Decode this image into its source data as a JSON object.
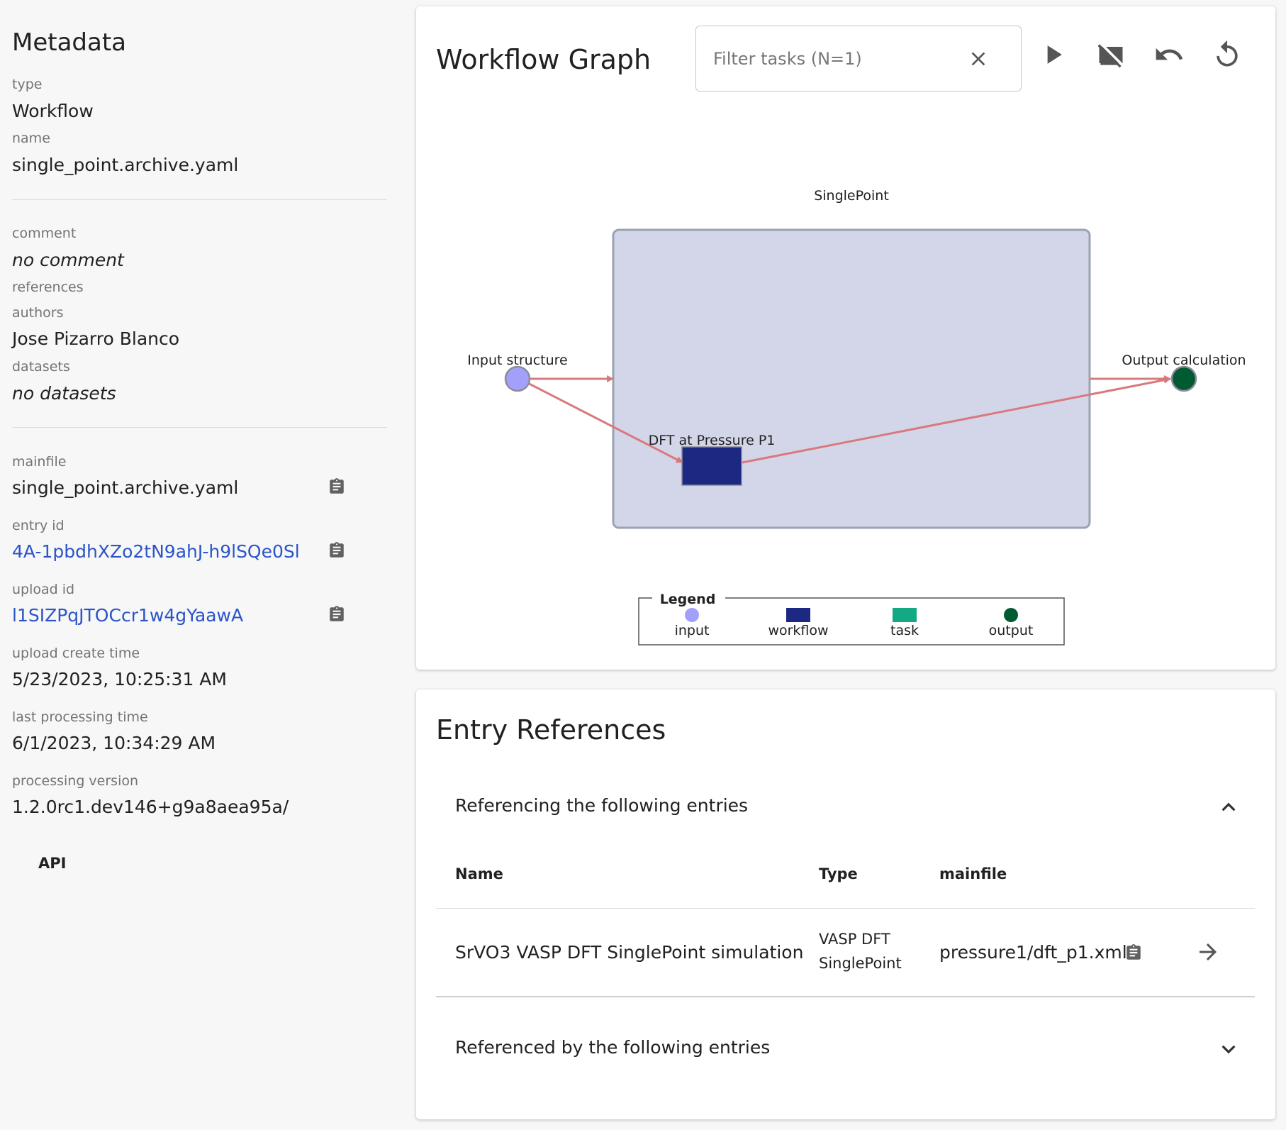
{
  "metadata": {
    "title": "Metadata",
    "type_label": "type",
    "type_value": "Workflow",
    "name_label": "name",
    "name_value": "single_point.archive.yaml",
    "comment_label": "comment",
    "comment_value": "no comment",
    "references_label": "references",
    "authors_label": "authors",
    "authors_value": "Jose Pizarro Blanco",
    "datasets_label": "datasets",
    "datasets_value": "no datasets",
    "mainfile_label": "mainfile",
    "mainfile_value": "single_point.archive.yaml",
    "entry_id_label": "entry id",
    "entry_id_value": "4A-1pbdhXZo2tN9ahJ-h9lSQe0Sl",
    "upload_id_label": "upload id",
    "upload_id_value": "l1SIZPqJTOCcr1w4gYaawA",
    "upload_create_time_label": "upload create time",
    "upload_create_time_value": "5/23/2023, 10:25:31 AM",
    "last_processing_time_label": "last processing time",
    "last_processing_time_value": "6/1/2023, 10:34:29 AM",
    "processing_version_label": "processing version",
    "processing_version_value": "1.2.0rc1.dev146+g9a8aea95a/",
    "api_label": "API"
  },
  "workflow": {
    "title": "Workflow Graph",
    "filter_placeholder": "Filter tasks (N=1)",
    "icons": [
      "close-icon",
      "play-icon",
      "hide-icon",
      "undo-icon",
      "reset-icon"
    ],
    "graph": {
      "workflow_label": "SinglePoint",
      "input_label": "Input structure",
      "output_label": "Output calculation",
      "task_label": "DFT at Pressure P1"
    },
    "legend": {
      "title": "Legend",
      "input": "input",
      "workflow": "workflow",
      "task": "task",
      "output": "output"
    },
    "colors": {
      "input": "#a3a0fb",
      "workflow_fill": "#d3d6e8",
      "task": "#1c2982",
      "task_legend": "#13a984",
      "output": "#015a32",
      "edge": "#d9797e"
    }
  },
  "references": {
    "title": "Entry References",
    "referencing_label": "Referencing the following entries",
    "referenced_by_label": "Referenced by the following entries",
    "columns": {
      "name": "Name",
      "type": "Type",
      "mainfile": "mainfile"
    },
    "rows": [
      {
        "name": "SrVO3 VASP DFT SinglePoint simulation",
        "type_line1": "VASP DFT",
        "type_line2": "SinglePoint",
        "mainfile": "pressure1/dft_p1.xml"
      }
    ]
  }
}
